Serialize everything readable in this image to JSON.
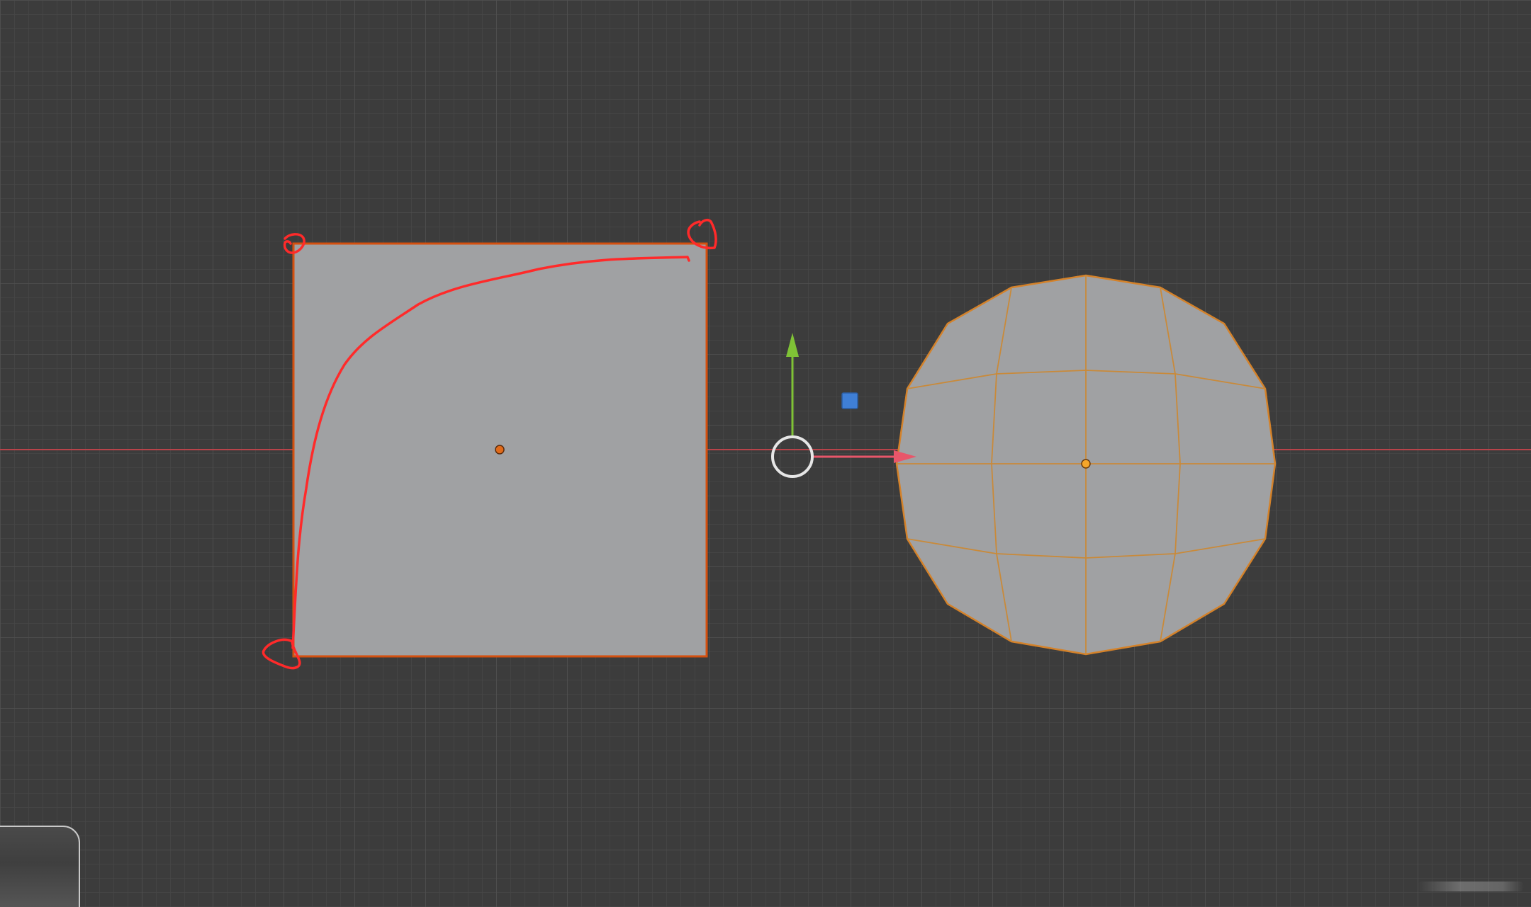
{
  "viewport": {
    "background": "#3c3c3c",
    "grid_minor_color": "#474747",
    "grid_major_color": "#4f4f4f",
    "x_axis_color": "#b8434a"
  },
  "objects": {
    "plane": {
      "fill": "#a0a1a3",
      "outline": "#d4500f",
      "origin_color": "#e06a1a"
    },
    "sphere": {
      "fill": "#a0a1a3",
      "wire": "#d4822a",
      "origin_color": "#f5a62a"
    }
  },
  "gizmo": {
    "y_arrow_color": "#7fc236",
    "x_arrow_color": "#e8566a",
    "plane_handle_color": "#3f7fd6",
    "center_ring_color": "#e6e6e6"
  },
  "annotation": {
    "stroke_color": "#ff2a2a"
  },
  "icons": {
    "gizmo_y": "arrow-up-icon",
    "gizmo_x": "arrow-right-icon",
    "gizmo_center": "circle-icon",
    "gizmo_plane": "square-icon"
  }
}
